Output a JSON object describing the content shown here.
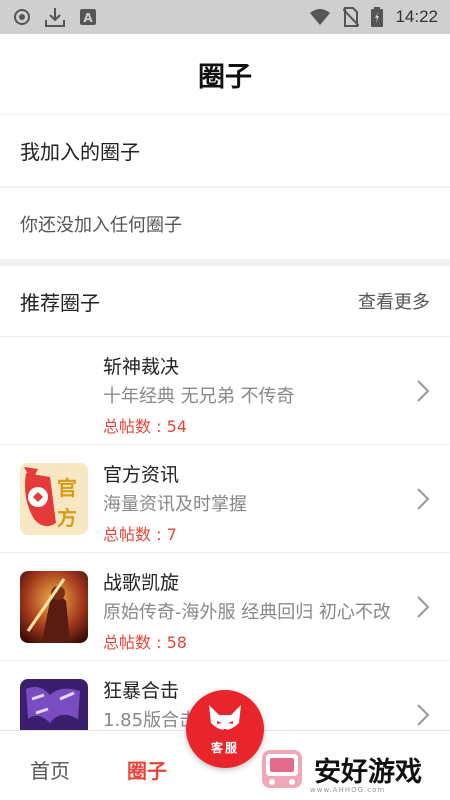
{
  "status_bar": {
    "time": "14:22"
  },
  "header": {
    "title": "圈子"
  },
  "joined": {
    "label": "我加入的圈子",
    "empty_text": "你还没加入任何圈子"
  },
  "recommended": {
    "label": "推荐圈子",
    "more": "查看更多"
  },
  "circles": [
    {
      "name": "斩神裁决",
      "desc": "十年经典 无兄弟 不传奇",
      "count": "总帖数 : 54"
    },
    {
      "name": "官方资讯",
      "desc": "海量资讯及时掌握",
      "count": "总帖数 : 7"
    },
    {
      "name": "战歌凯旋",
      "desc": "原始传奇-海外服 经典回归 初心不改",
      "count": "总帖数 : 58"
    },
    {
      "name": "狂暴合击",
      "desc": "1.85版合击",
      "count": ""
    }
  ],
  "fab": {
    "label": "客服"
  },
  "nav": {
    "home": "首页",
    "circle": "圈子"
  },
  "watermark": {
    "text": "安好游戏",
    "sub": "www.AHHOG.com"
  },
  "colors": {
    "accent": "#e8453a",
    "fab": "#e8252a"
  }
}
